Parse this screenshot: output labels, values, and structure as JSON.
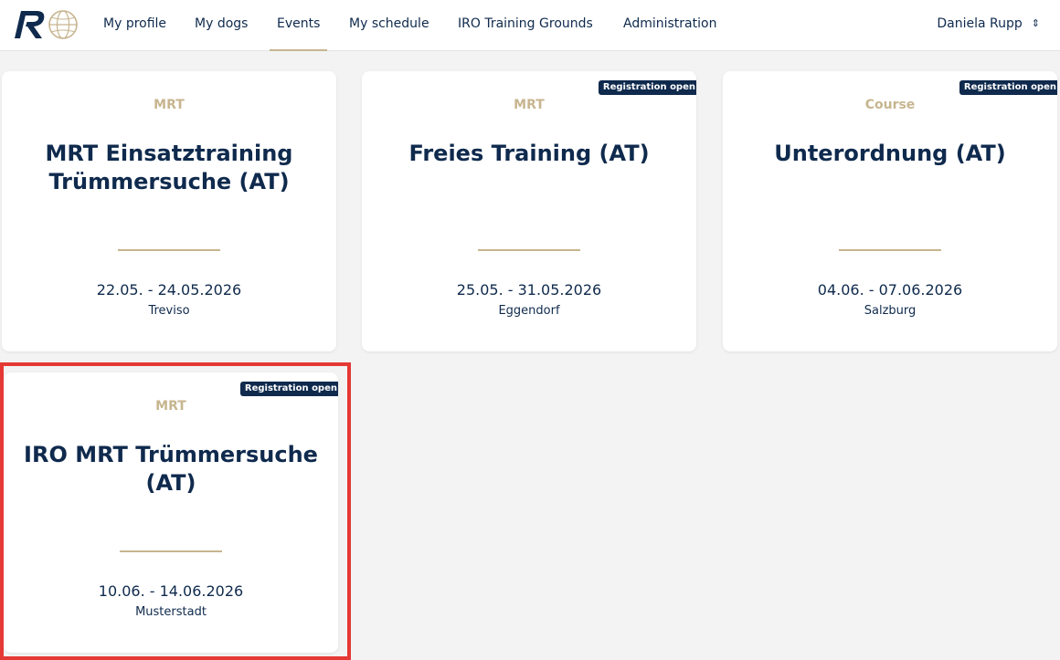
{
  "nav": {
    "items": [
      {
        "label": "My profile"
      },
      {
        "label": "My dogs"
      },
      {
        "label": "Events"
      },
      {
        "label": "My schedule"
      },
      {
        "label": "IRO Training Grounds"
      },
      {
        "label": "Administration"
      }
    ],
    "active": "Events",
    "user_name": "Daniela Rupp",
    "user_chevron": "⌃⌄"
  },
  "events": [
    {
      "badge": "",
      "category": "MRT",
      "title": "MRT Einsatztraining Trümmersuche (AT)",
      "dates": "22.05. - 24.05.2026",
      "location": "Treviso"
    },
    {
      "badge": "Registration open",
      "category": "MRT",
      "title": "Freies Training (AT)",
      "dates": "25.05. - 31.05.2026",
      "location": "Eggendorf"
    },
    {
      "badge": "Registration open",
      "category": "Course",
      "title": "Unterordnung (AT)",
      "dates": "04.06. - 07.06.2026",
      "location": "Salzburg"
    },
    {
      "badge": "Registration open",
      "category": "MRT",
      "title": "IRO MRT Trümmersuche (AT)",
      "dates": "10.06. - 14.06.2026",
      "location": "Musterstadt"
    }
  ],
  "colors": {
    "navy": "#0f2a4d",
    "gold": "#c7b58f",
    "highlight": "#e53935",
    "background": "#f3f3f3"
  }
}
